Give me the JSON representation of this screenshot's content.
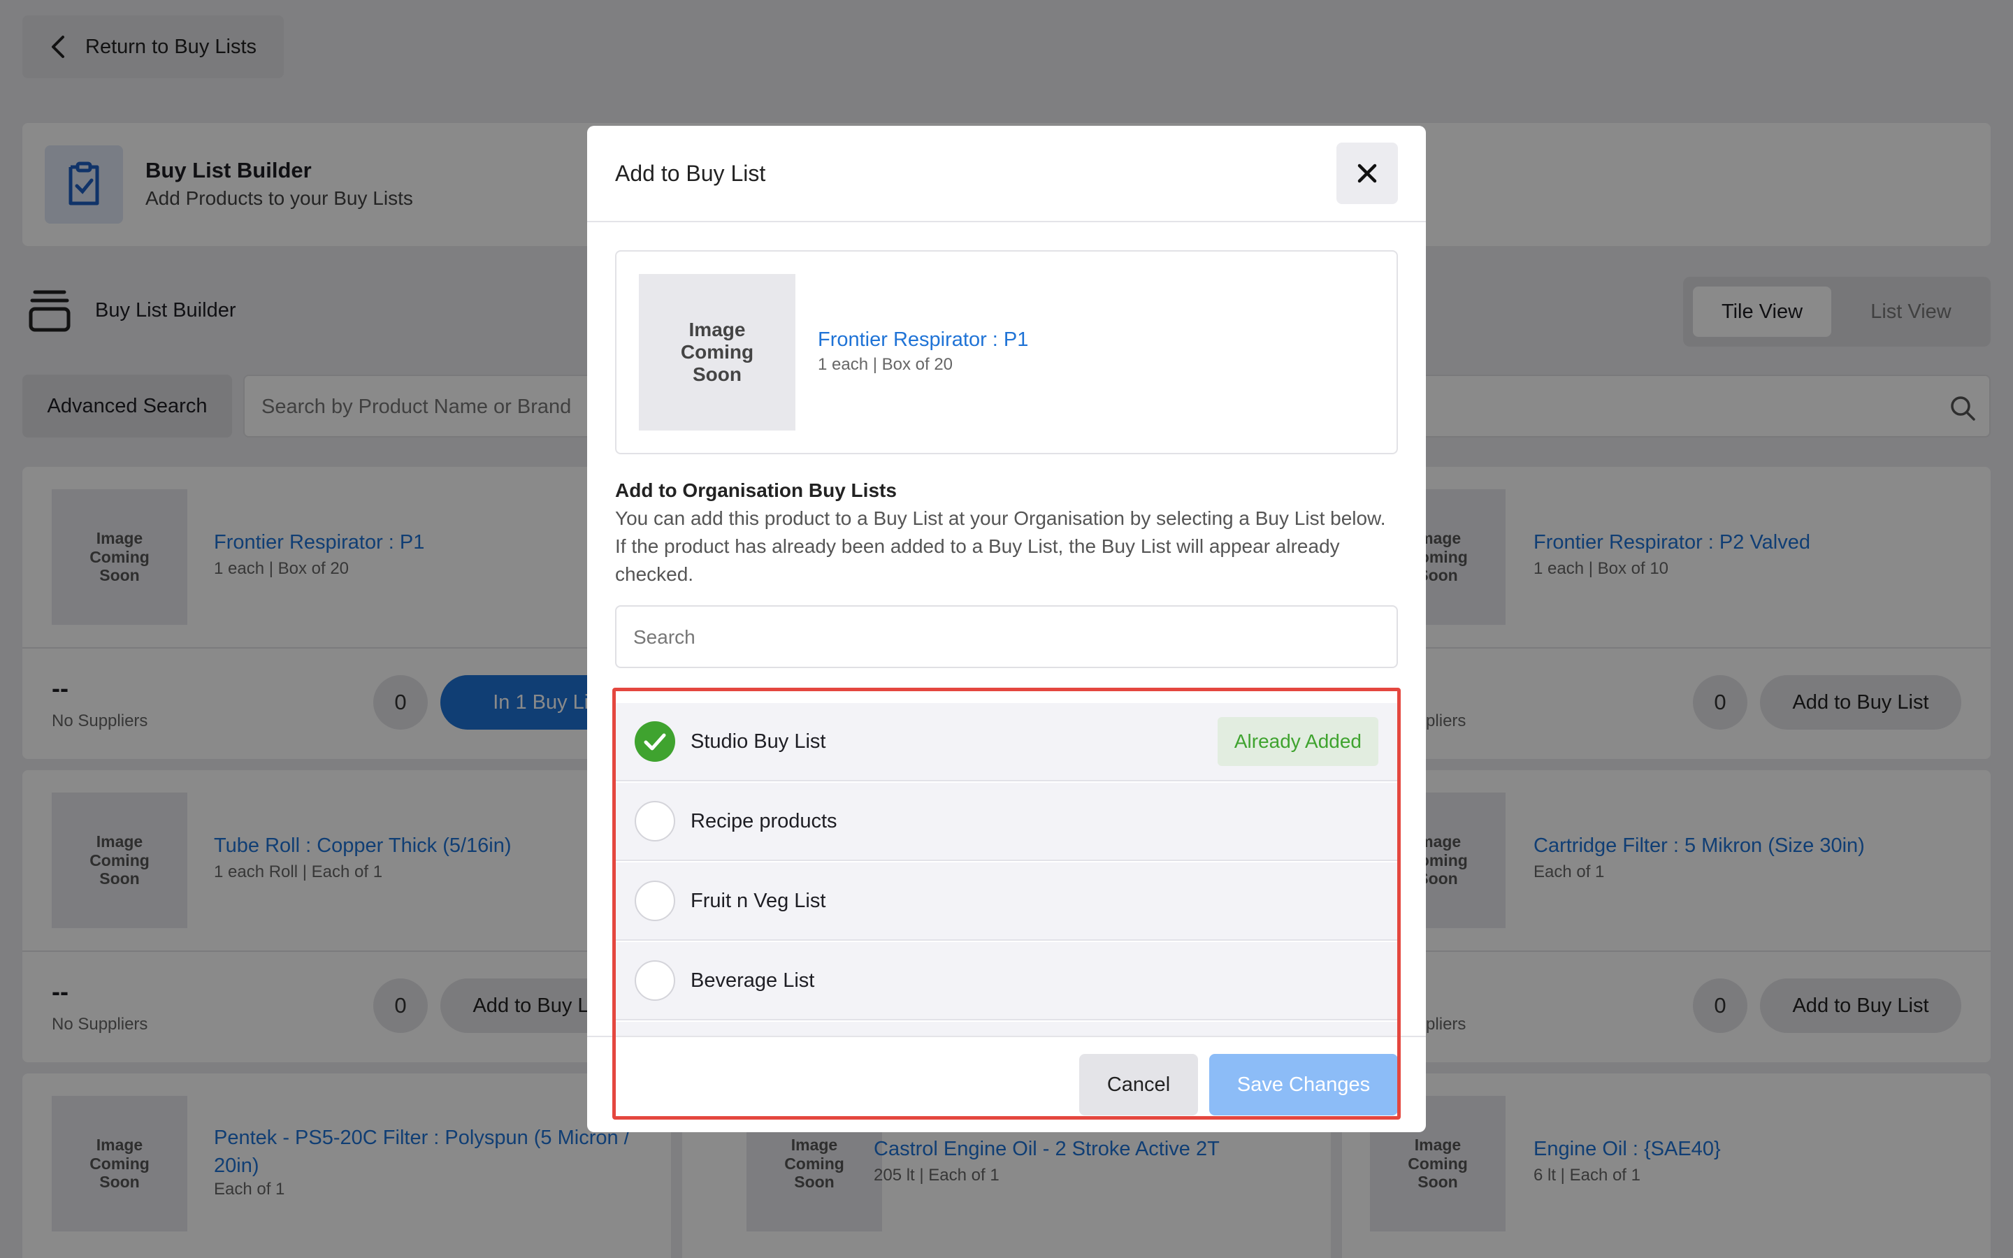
{
  "back_button": {
    "label": "Return to Buy Lists"
  },
  "header": {
    "title": "Buy List Builder",
    "subtitle": "Add Products to your Buy Lists"
  },
  "section": {
    "title": "Buy List Builder"
  },
  "view_toggle": {
    "tile": "Tile View",
    "list": "List View"
  },
  "search_bar": {
    "advanced": "Advanced Search",
    "placeholder": "Search by Product Name or Brand"
  },
  "image_placeholder": "Image\nComing\nSoon",
  "products": [
    {
      "name": "Frontier Respirator : P1",
      "sub": "1 each | Box of 20",
      "price": "--",
      "supplier": "No Suppliers",
      "qty": "0",
      "action": "In 1 Buy List"
    },
    {
      "name": "Frontier Respirator : P2 Valved",
      "sub": "1 each | Box of 10",
      "supplier": "No Suppliers",
      "qty": "0",
      "action": "Add to Buy List"
    },
    {
      "name": "Tube Roll : Copper Thick (5/16in)",
      "sub": "1 each Roll | Each of 1",
      "price": "--",
      "supplier": "No Suppliers",
      "qty": "0",
      "action": "Add to Buy List"
    },
    {
      "name": "Cartridge Filter : 5 Mikron (Size 30in)",
      "sub": "Each of 1",
      "supplier": "No Suppliers",
      "qty": "0",
      "action": "Add to Buy List"
    },
    {
      "name": "Pentek - PS5-20C Filter : Polyspun (5 Micron / 20in)",
      "sub": "Each of 1"
    },
    {
      "name": "Castrol Engine Oil - 2 Stroke Active 2T",
      "sub": "205 lt | Each of 1"
    },
    {
      "name": "Engine Oil : {SAE40}",
      "sub": "6 lt | Each of 1"
    }
  ],
  "modal": {
    "title": "Add to Buy List",
    "product": {
      "name": "Frontier Respirator : P1",
      "sub": "1 each | Box of 20"
    },
    "org_heading": "Add to Organisation Buy Lists",
    "org_desc": "You can add this product to a Buy List at your Organisation by selecting a Buy List below. If the product has already been added to a Buy List, the Buy List will appear already checked.",
    "search_placeholder": "Search",
    "lists": [
      {
        "name": "Studio Buy List",
        "checked": true,
        "badge": "Already Added"
      },
      {
        "name": "Recipe products",
        "checked": false
      },
      {
        "name": "Fruit n Veg List",
        "checked": false
      },
      {
        "name": "Beverage List",
        "checked": false
      }
    ],
    "cancel": "Cancel",
    "save": "Save Changes"
  },
  "colors": {
    "accent": "#1f73d6",
    "highlight": "#e4473f",
    "success": "#3fa32f",
    "save_disabled": "#8cbcf7"
  }
}
